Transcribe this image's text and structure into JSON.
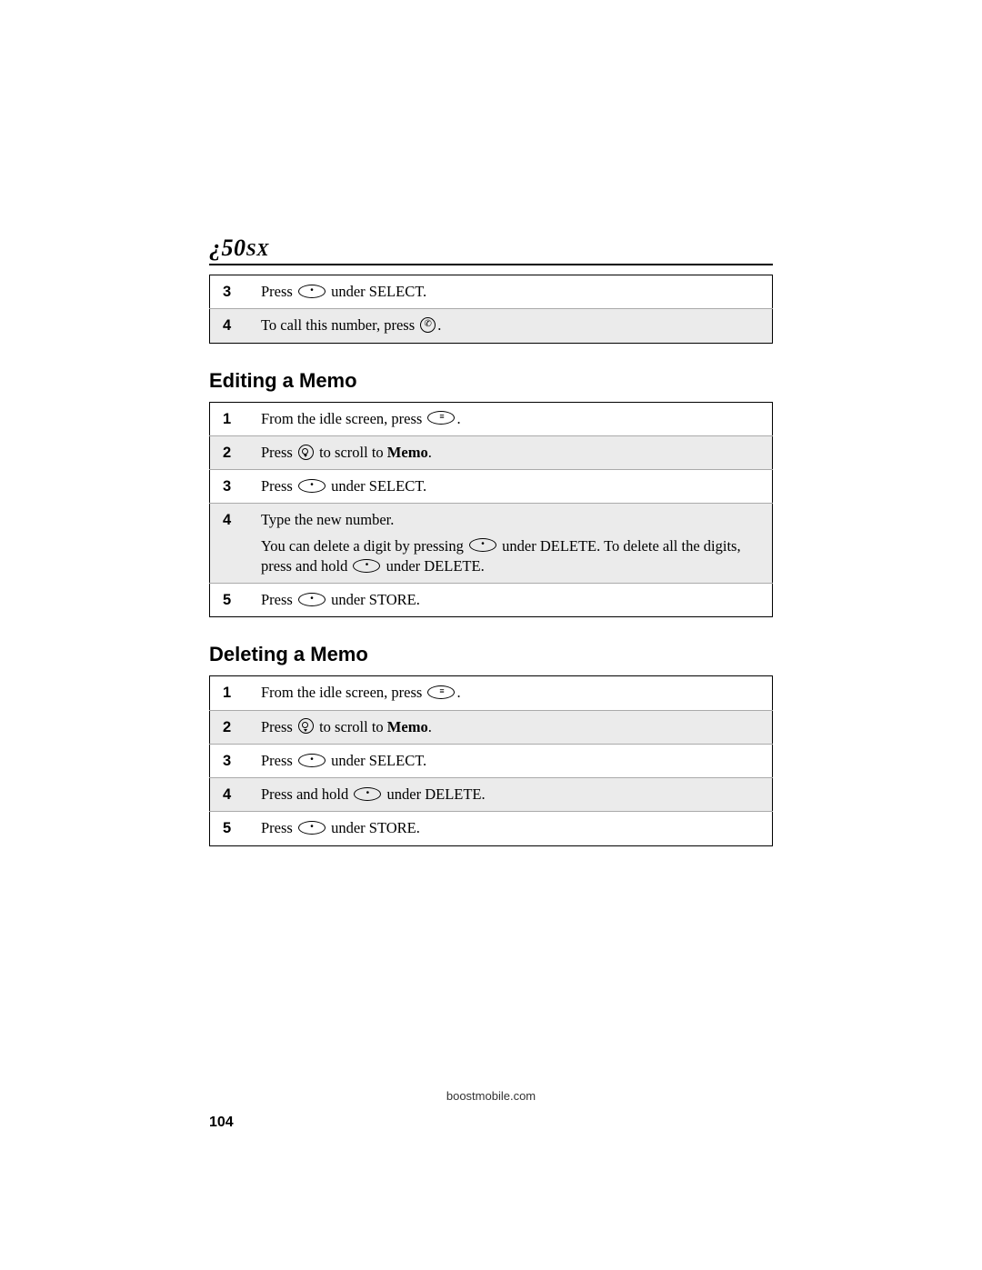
{
  "header": {
    "model_prefix": "¿",
    "model_num": "50",
    "model_suffix": "SX"
  },
  "top_table": {
    "rows": [
      {
        "num": "3",
        "pre": "Press ",
        "key": "oval-dot",
        "post": " under SELECT."
      },
      {
        "num": "4",
        "pre": "To call this number, press ",
        "key": "round-call",
        "post": "."
      }
    ]
  },
  "sections": [
    {
      "title": "Editing a Memo",
      "rows": [
        {
          "num": "1",
          "pre": "From the idle screen, press ",
          "key": "oval-menu",
          "post": "."
        },
        {
          "num": "2",
          "pre": "Press ",
          "key": "round-nav",
          "post": " to scroll to ",
          "bold": "Memo",
          "tail": "."
        },
        {
          "num": "3",
          "pre": "Press ",
          "key": "oval-dot",
          "post": " under SELECT."
        },
        {
          "num": "4",
          "pre": "Type the new number.",
          "sub_pre": "You can delete a digit by pressing ",
          "sub_key1": "oval-dot",
          "sub_mid": " under DELETE. To delete all the digits, press and hold ",
          "sub_key2": "oval-dot",
          "sub_post": " under DELETE."
        },
        {
          "num": "5",
          "pre": "Press ",
          "key": "oval-dot",
          "post": " under STORE."
        }
      ]
    },
    {
      "title": "Deleting a Memo",
      "rows": [
        {
          "num": "1",
          "pre": "From the idle screen, press ",
          "key": "oval-menu",
          "post": "."
        },
        {
          "num": "2",
          "pre": "Press ",
          "key": "round-nav",
          "post": " to scroll to ",
          "bold": "Memo",
          "tail": "."
        },
        {
          "num": "3",
          "pre": "Press ",
          "key": "oval-dot",
          "post": " under SELECT."
        },
        {
          "num": "4",
          "pre": "Press and hold ",
          "key": "oval-dot",
          "post": " under DELETE."
        },
        {
          "num": "5",
          "pre": "Press ",
          "key": "oval-dot",
          "post": " under STORE."
        }
      ]
    }
  ],
  "footer": {
    "url": "boostmobile.com",
    "page": "104"
  }
}
